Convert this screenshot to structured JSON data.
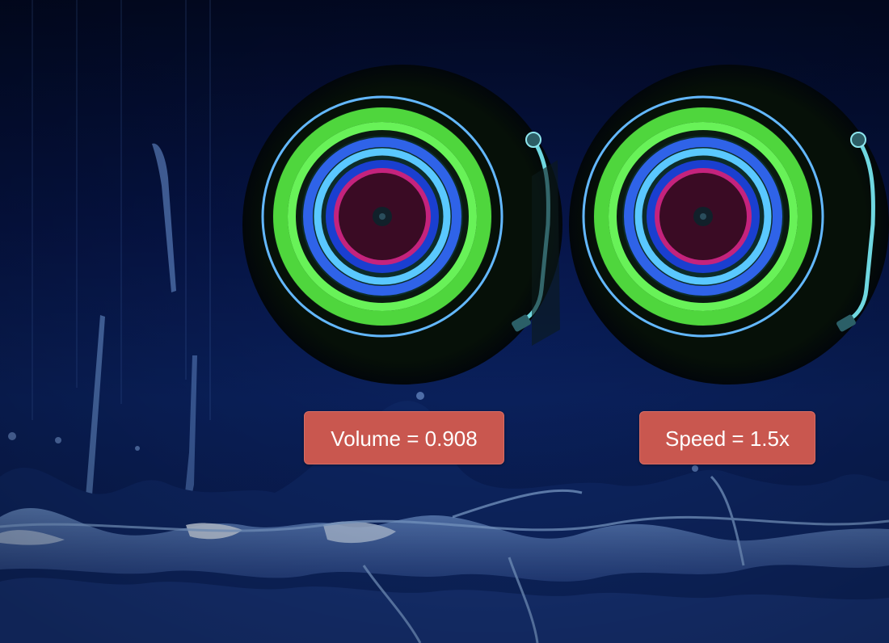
{
  "controls": {
    "volume_label": "Volume = 0.908",
    "speed_label": "Speed = 1.5x"
  },
  "decks": [
    {
      "name": "left-turntable",
      "icon": "vinyl-record-icon"
    },
    {
      "name": "right-turntable",
      "icon": "vinyl-record-icon"
    }
  ],
  "colors": {
    "background_dark": "#020a26",
    "background_mid": "#0b2466",
    "wave_light": "#8fb6ec",
    "ring_green": "#5cf04a",
    "ring_blue": "#2f6bff",
    "ring_cyan": "#56c7ff",
    "ring_magenta": "#b0307a",
    "pill_red": "#c9574f"
  }
}
